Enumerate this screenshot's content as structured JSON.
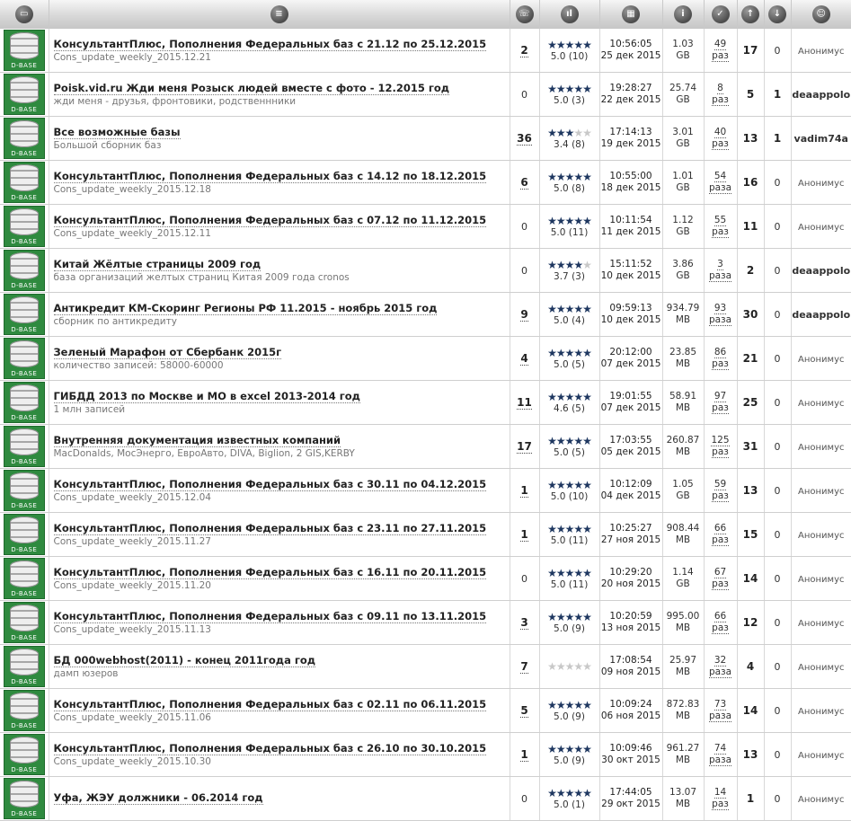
{
  "header_icons": [
    "folder-icon",
    "document-icon",
    "comments-icon",
    "rating-icon",
    "date-icon",
    "info-icon",
    "downloads-icon",
    "seeders-icon",
    "leechers-icon",
    "author-icon"
  ],
  "db_icon_label": "D-BASE",
  "rows": [
    {
      "title": "КонсультантПлюс, Пополнения Федеральных баз с 21.12 по 25.12.2015",
      "sub": "Cons_update_weekly_2015.12.21",
      "comments": "2",
      "rating": 5.0,
      "votes": "5.0 (10)",
      "time": "10:56:05",
      "date": "25 дек 2015",
      "size": "1.03",
      "unit": "GB",
      "dl": "49",
      "dlu": "раз",
      "seed": "17",
      "leech": "0",
      "author": "Анонимус",
      "anon": true
    },
    {
      "title": "Poisk.vid.ru Жди меня Розыск людей вместе с фото - 12.2015 год",
      "sub": "жди меня - друзья, фронтовики, родственнники",
      "comments": "0",
      "rating": 5.0,
      "votes": "5.0 (3)",
      "time": "19:28:27",
      "date": "22 дек 2015",
      "size": "25.74",
      "unit": "GB",
      "dl": "8",
      "dlu": "раз",
      "seed": "5",
      "leech": "1",
      "author": "deaappolo",
      "anon": false
    },
    {
      "title": "Все возможные базы",
      "sub": "Большой сборник баз",
      "comments": "36",
      "rating": 3.4,
      "votes": "3.4 (8)",
      "time": "17:14:13",
      "date": "19 дек 2015",
      "size": "3.01",
      "unit": "GB",
      "dl": "40",
      "dlu": "раз",
      "seed": "13",
      "leech": "1",
      "author": "vadim74a",
      "anon": false
    },
    {
      "title": "КонсультантПлюс, Пополнения Федеральных баз с 14.12 по 18.12.2015",
      "sub": "Cons_update_weekly_2015.12.18",
      "comments": "6",
      "rating": 5.0,
      "votes": "5.0 (8)",
      "time": "10:55:00",
      "date": "18 дек 2015",
      "size": "1.01",
      "unit": "GB",
      "dl": "54",
      "dlu": "раза",
      "seed": "16",
      "leech": "0",
      "author": "Анонимус",
      "anon": true
    },
    {
      "title": "КонсультантПлюс, Пополнения Федеральных баз с 07.12 по 11.12.2015",
      "sub": "Cons_update_weekly_2015.12.11",
      "comments": "0",
      "rating": 5.0,
      "votes": "5.0 (11)",
      "time": "10:11:54",
      "date": "11 дек 2015",
      "size": "1.12",
      "unit": "GB",
      "dl": "55",
      "dlu": "раз",
      "seed": "11",
      "leech": "0",
      "author": "Анонимус",
      "anon": true
    },
    {
      "title": "Китай Жёлтые страницы 2009 год",
      "sub": "база организаций желтых страниц Китая 2009 года cronos",
      "comments": "0",
      "rating": 3.7,
      "votes": "3.7 (3)",
      "time": "15:11:52",
      "date": "10 дек 2015",
      "size": "3.86",
      "unit": "GB",
      "dl": "3",
      "dlu": "раза",
      "seed": "2",
      "leech": "0",
      "author": "deaappolo",
      "anon": false
    },
    {
      "title": "Антикредит КМ-Скоринг Регионы РФ 11.2015 - ноябрь 2015 год",
      "sub": "сборник по антикредиту",
      "comments": "9",
      "rating": 5.0,
      "votes": "5.0 (4)",
      "time": "09:59:13",
      "date": "10 дек 2015",
      "size": "934.79",
      "unit": "MB",
      "dl": "93",
      "dlu": "раза",
      "seed": "30",
      "leech": "0",
      "author": "deaappolo",
      "anon": false
    },
    {
      "title": "Зеленый Марафон от Сбербанк 2015г",
      "sub": "количество записей: 58000-60000",
      "comments": "4",
      "rating": 5.0,
      "votes": "5.0 (5)",
      "time": "20:12:00",
      "date": "07 дек 2015",
      "size": "23.85",
      "unit": "MB",
      "dl": "86",
      "dlu": "раз",
      "seed": "21",
      "leech": "0",
      "author": "Анонимус",
      "anon": true
    },
    {
      "title": "ГИБДД 2013 по Москве и МО в excel 2013-2014 год",
      "sub": "1 млн записей",
      "comments": "11",
      "rating": 4.6,
      "votes": "4.6 (5)",
      "time": "19:01:55",
      "date": "07 дек 2015",
      "size": "58.91",
      "unit": "MB",
      "dl": "97",
      "dlu": "раз",
      "seed": "25",
      "leech": "0",
      "author": "Анонимус",
      "anon": true
    },
    {
      "title": "Внутренняя документация известных компаний",
      "sub": "MacDonalds, МосЭнерго, ЕвроАвто, DIVA, Biglion, 2 GIS,KERBY",
      "comments": "17",
      "rating": 5.0,
      "votes": "5.0 (5)",
      "time": "17:03:55",
      "date": "05 дек 2015",
      "size": "260.87",
      "unit": "MB",
      "dl": "125",
      "dlu": "раз",
      "seed": "31",
      "leech": "0",
      "author": "Анонимус",
      "anon": true
    },
    {
      "title": "КонсультантПлюс, Пополнения Федеральных баз с 30.11 по 04.12.2015",
      "sub": "Cons_update_weekly_2015.12.04",
      "comments": "1",
      "rating": 5.0,
      "votes": "5.0 (10)",
      "time": "10:12:09",
      "date": "04 дек 2015",
      "size": "1.05",
      "unit": "GB",
      "dl": "59",
      "dlu": "раз",
      "seed": "13",
      "leech": "0",
      "author": "Анонимус",
      "anon": true
    },
    {
      "title": "КонсультантПлюс, Пополнения Федеральных баз с 23.11 по 27.11.2015",
      "sub": "Cons_update_weekly_2015.11.27",
      "comments": "1",
      "rating": 5.0,
      "votes": "5.0 (11)",
      "time": "10:25:27",
      "date": "27 ноя 2015",
      "size": "908.44",
      "unit": "MB",
      "dl": "66",
      "dlu": "раз",
      "seed": "15",
      "leech": "0",
      "author": "Анонимус",
      "anon": true
    },
    {
      "title": "КонсультантПлюс, Пополнения Федеральных баз с 16.11 по 20.11.2015",
      "sub": "Cons_update_weekly_2015.11.20",
      "comments": "0",
      "rating": 5.0,
      "votes": "5.0 (11)",
      "time": "10:29:20",
      "date": "20 ноя 2015",
      "size": "1.14",
      "unit": "GB",
      "dl": "67",
      "dlu": "раз",
      "seed": "14",
      "leech": "0",
      "author": "Анонимус",
      "anon": true
    },
    {
      "title": "КонсультантПлюс, Пополнения Федеральных баз с 09.11 по 13.11.2015",
      "sub": "Cons_update_weekly_2015.11.13",
      "comments": "3",
      "rating": 5.0,
      "votes": "5.0 (9)",
      "time": "10:20:59",
      "date": "13 ноя 2015",
      "size": "995.00",
      "unit": "MB",
      "dl": "66",
      "dlu": "раз",
      "seed": "12",
      "leech": "0",
      "author": "Анонимус",
      "anon": true
    },
    {
      "title": "БД 000webhost(2011) - конец 2011года год",
      "sub": "дамп юзеров",
      "comments": "7",
      "rating": 0,
      "votes": "",
      "time": "17:08:54",
      "date": "09 ноя 2015",
      "size": "25.97",
      "unit": "MB",
      "dl": "32",
      "dlu": "раза",
      "seed": "4",
      "leech": "0",
      "author": "Анонимус",
      "anon": true
    },
    {
      "title": "КонсультантПлюс, Пополнения Федеральных баз с 02.11 по 06.11.2015",
      "sub": "Cons_update_weekly_2015.11.06",
      "comments": "5",
      "rating": 5.0,
      "votes": "5.0 (9)",
      "time": "10:09:24",
      "date": "06 ноя 2015",
      "size": "872.83",
      "unit": "MB",
      "dl": "73",
      "dlu": "раза",
      "seed": "14",
      "leech": "0",
      "author": "Анонимус",
      "anon": true
    },
    {
      "title": "КонсультантПлюс, Пополнения Федеральных баз с 26.10 по 30.10.2015",
      "sub": "Cons_update_weekly_2015.10.30",
      "comments": "1",
      "rating": 5.0,
      "votes": "5.0 (9)",
      "time": "10:09:46",
      "date": "30 окт 2015",
      "size": "961.27",
      "unit": "MB",
      "dl": "74",
      "dlu": "раза",
      "seed": "13",
      "leech": "0",
      "author": "Анонимус",
      "anon": true
    },
    {
      "title": "Уфа, ЖЭУ должники - 06.2014 год",
      "sub": "",
      "comments": "0",
      "rating": 5.0,
      "votes": "5.0 (1)",
      "time": "17:44:05",
      "date": "29 окт 2015",
      "size": "13.07",
      "unit": "MB",
      "dl": "14",
      "dlu": "раз",
      "seed": "1",
      "leech": "0",
      "author": "Анонимус",
      "anon": true
    }
  ]
}
